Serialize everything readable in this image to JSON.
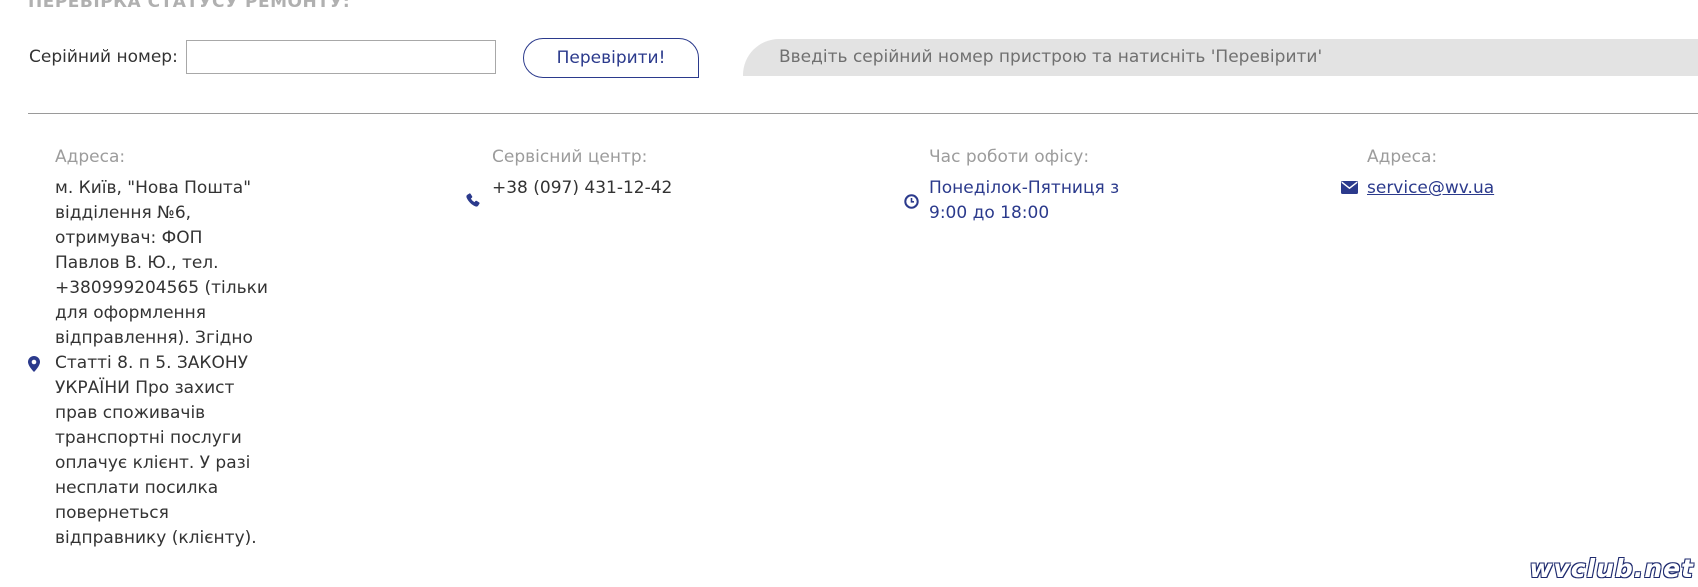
{
  "repair_check": {
    "title": "ПЕРЕВІРКА СТАТУСУ РЕМОНТУ:",
    "serial_label": "Серійний номер:",
    "serial_value": "",
    "serial_placeholder": "",
    "check_button_label": "Перевірити!",
    "status_message": "Введіть серійний номер пристрою та натисніть 'Перевірити'"
  },
  "footer": {
    "address": {
      "heading": "Адреса:",
      "text": "м. Київ, \"Нова Пошта\" відділення №6, отримувач: ФОП Павлов В. Ю., тел. +380999204565 (тільки для оформлення відправлення). Згідно Статті 8. п 5. ЗАКОНУ УКРАЇНИ Про захист прав споживачів транспортні послуги оплачує клієнт. У разі несплати посилка повернеться відправнику (клієнту).",
      "icon": "map-marker-icon"
    },
    "service_center": {
      "heading": "Сервісний центр:",
      "phone": "+38 (097) 431-12-42",
      "icon": "phone-icon"
    },
    "office_hours": {
      "heading": "Час роботи офісу:",
      "hours": "Понеділок-Пятниця з 9:00 до 18:00",
      "icon": "clock-icon"
    },
    "email": {
      "heading": "Адреса:",
      "address": "service@wv.ua",
      "icon": "envelope-icon"
    }
  },
  "watermark": "wvclub.net",
  "colors": {
    "accent": "#2b3a8c",
    "heading_gray": "#9c9c9c",
    "status_bar_bg": "#e3e3e3",
    "text": "#333333"
  }
}
